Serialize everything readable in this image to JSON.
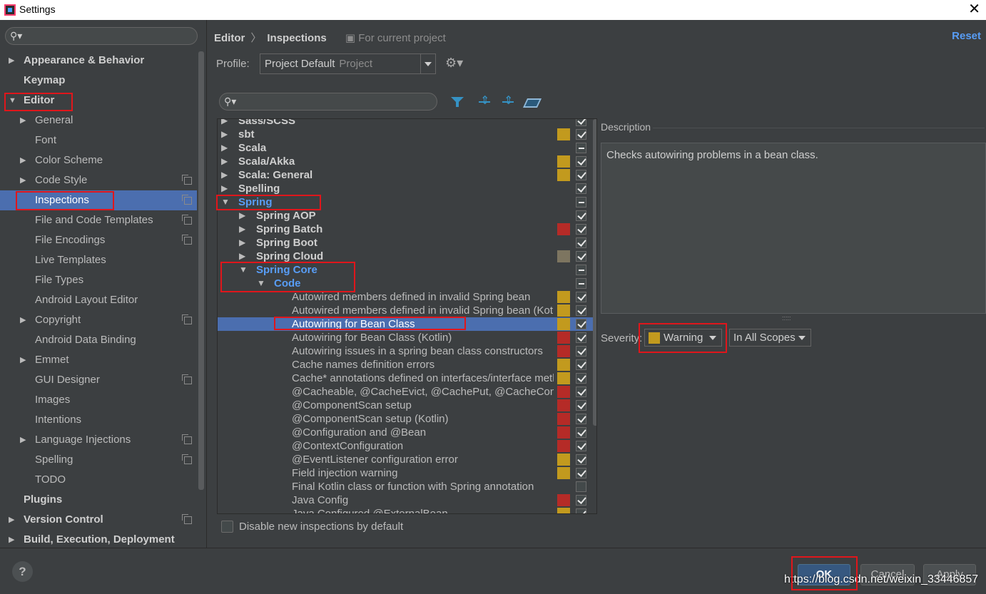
{
  "window": {
    "title": "Settings"
  },
  "left_search": {
    "placeholder": ""
  },
  "nav": [
    {
      "label": "Appearance & Behavior",
      "level": 0,
      "arrow": "▶"
    },
    {
      "label": "Keymap",
      "level": 0,
      "arrow": ""
    },
    {
      "label": "Editor",
      "level": 0,
      "arrow": "▼"
    },
    {
      "label": "General",
      "level": 1,
      "arrow": "▶"
    },
    {
      "label": "Font",
      "level": 1,
      "arrow": ""
    },
    {
      "label": "Color Scheme",
      "level": 1,
      "arrow": "▶"
    },
    {
      "label": "Code Style",
      "level": 1,
      "arrow": "▶",
      "copy": true
    },
    {
      "label": "Inspections",
      "level": 1,
      "arrow": "",
      "copy": true,
      "selected": true
    },
    {
      "label": "File and Code Templates",
      "level": 1,
      "arrow": "",
      "copy": true
    },
    {
      "label": "File Encodings",
      "level": 1,
      "arrow": "",
      "copy": true
    },
    {
      "label": "Live Templates",
      "level": 1,
      "arrow": ""
    },
    {
      "label": "File Types",
      "level": 1,
      "arrow": ""
    },
    {
      "label": "Android Layout Editor",
      "level": 1,
      "arrow": ""
    },
    {
      "label": "Copyright",
      "level": 1,
      "arrow": "▶",
      "copy": true
    },
    {
      "label": "Android Data Binding",
      "level": 1,
      "arrow": ""
    },
    {
      "label": "Emmet",
      "level": 1,
      "arrow": "▶"
    },
    {
      "label": "GUI Designer",
      "level": 1,
      "arrow": "",
      "copy": true
    },
    {
      "label": "Images",
      "level": 1,
      "arrow": ""
    },
    {
      "label": "Intentions",
      "level": 1,
      "arrow": ""
    },
    {
      "label": "Language Injections",
      "level": 1,
      "arrow": "▶",
      "copy": true
    },
    {
      "label": "Spelling",
      "level": 1,
      "arrow": "",
      "copy": true
    },
    {
      "label": "TODO",
      "level": 1,
      "arrow": ""
    },
    {
      "label": "Plugins",
      "level": 0,
      "arrow": ""
    },
    {
      "label": "Version Control",
      "level": 0,
      "arrow": "▶",
      "copy": true
    },
    {
      "label": "Build, Execution, Deployment",
      "level": 0,
      "arrow": "▶"
    }
  ],
  "breadcrumb": {
    "part1": "Editor",
    "sep": "〉",
    "part2": "Inspections",
    "scope": "For current project"
  },
  "reset_label": "Reset",
  "profile": {
    "label": "Profile:",
    "value": "Project Default",
    "sub": "Project"
  },
  "right_search": {
    "placeholder": ""
  },
  "inspections": [
    {
      "label": "Sass/SCSS",
      "level": 0,
      "arrow": "▶",
      "group": true,
      "sev": "",
      "check": "on"
    },
    {
      "label": "sbt",
      "level": 0,
      "arrow": "▶",
      "group": true,
      "sev": "#c29a1e",
      "check": "on"
    },
    {
      "label": "Scala",
      "level": 0,
      "arrow": "▶",
      "group": true,
      "sev": "",
      "check": "partial"
    },
    {
      "label": "Scala/Akka",
      "level": 0,
      "arrow": "▶",
      "group": true,
      "sev": "#c29a1e",
      "check": "on"
    },
    {
      "label": "Scala: General",
      "level": 0,
      "arrow": "▶",
      "group": true,
      "sev": "#c29a1e",
      "check": "on"
    },
    {
      "label": "Spelling",
      "level": 0,
      "arrow": "▶",
      "group": true,
      "sev": "",
      "check": "on"
    },
    {
      "label": "Spring",
      "level": 0,
      "arrow": "▼",
      "group": true,
      "blue": true,
      "sev": "",
      "check": "partial"
    },
    {
      "label": "Spring AOP",
      "level": 1,
      "arrow": "▶",
      "group": true,
      "sev": "",
      "check": "on"
    },
    {
      "label": "Spring Batch",
      "level": 1,
      "arrow": "▶",
      "group": true,
      "sev": "#b52b27",
      "check": "on"
    },
    {
      "label": "Spring Boot",
      "level": 1,
      "arrow": "▶",
      "group": true,
      "sev": "",
      "check": "on"
    },
    {
      "label": "Spring Cloud",
      "level": 1,
      "arrow": "▶",
      "group": true,
      "sev": "#7d7560",
      "check": "on"
    },
    {
      "label": "Spring Core",
      "level": 1,
      "arrow": "▼",
      "group": true,
      "blue": true,
      "sev": "",
      "check": "partial"
    },
    {
      "label": "Code",
      "level": 2,
      "arrow": "▼",
      "group": true,
      "blue": true,
      "sev": "",
      "check": "partial"
    },
    {
      "label": "Autowired members defined in invalid Spring bean",
      "level": 3,
      "sev": "#c29a1e",
      "check": "on"
    },
    {
      "label": "Autowired members defined in invalid Spring bean (Kotlin)",
      "level": 3,
      "sev": "#c29a1e",
      "check": "on"
    },
    {
      "label": "Autowiring for Bean Class",
      "level": 3,
      "sev": "#c29a1e",
      "check": "on",
      "selected": true
    },
    {
      "label": "Autowiring for Bean Class (Kotlin)",
      "level": 3,
      "sev": "#b52b27",
      "check": "on"
    },
    {
      "label": "Autowiring issues in a spring bean class constructors",
      "level": 3,
      "sev": "#b52b27",
      "check": "on"
    },
    {
      "label": "Cache names definition errors",
      "level": 3,
      "sev": "#c29a1e",
      "check": "on"
    },
    {
      "label": "Cache* annotations defined on interfaces/interface methods",
      "level": 3,
      "sev": "#c29a1e",
      "check": "on"
    },
    {
      "label": "@Cacheable, @CacheEvict, @CachePut, @CacheConfig",
      "level": 3,
      "sev": "#b52b27",
      "check": "on"
    },
    {
      "label": "@ComponentScan setup",
      "level": 3,
      "sev": "#b52b27",
      "check": "on"
    },
    {
      "label": "@ComponentScan setup (Kotlin)",
      "level": 3,
      "sev": "#b52b27",
      "check": "on"
    },
    {
      "label": "@Configuration and @Bean",
      "level": 3,
      "sev": "#b52b27",
      "check": "on"
    },
    {
      "label": "@ContextConfiguration",
      "level": 3,
      "sev": "#b52b27",
      "check": "on"
    },
    {
      "label": "@EventListener configuration error",
      "level": 3,
      "sev": "#c29a1e",
      "check": "on"
    },
    {
      "label": "Field injection warning",
      "level": 3,
      "sev": "#c29a1e",
      "check": "on"
    },
    {
      "label": "Final Kotlin class or function with Spring annotation",
      "level": 3,
      "sev": "",
      "check": "off"
    },
    {
      "label": "Java Config",
      "level": 3,
      "sev": "#b52b27",
      "check": "on"
    },
    {
      "label": "Java Configured @ExternalBean",
      "level": 3,
      "sev": "#c29a1e",
      "check": "on"
    }
  ],
  "disable_new": {
    "label": "Disable new inspections by default",
    "checked": false
  },
  "description": {
    "title": "Description",
    "text": "Checks autowiring problems in a bean class."
  },
  "severity": {
    "label": "Severity:",
    "value": "Warning",
    "color": "#c29a1e",
    "scope": "In All Scopes"
  },
  "buttons": {
    "help": "?",
    "ok": "OK",
    "cancel": "Cancel",
    "apply": "Apply"
  },
  "watermark": "https://blog.csdn.net/weixin_33446857",
  "colors": {
    "selection": "#4b6eaf",
    "link": "#589df6",
    "highlight": "#e0161b"
  }
}
